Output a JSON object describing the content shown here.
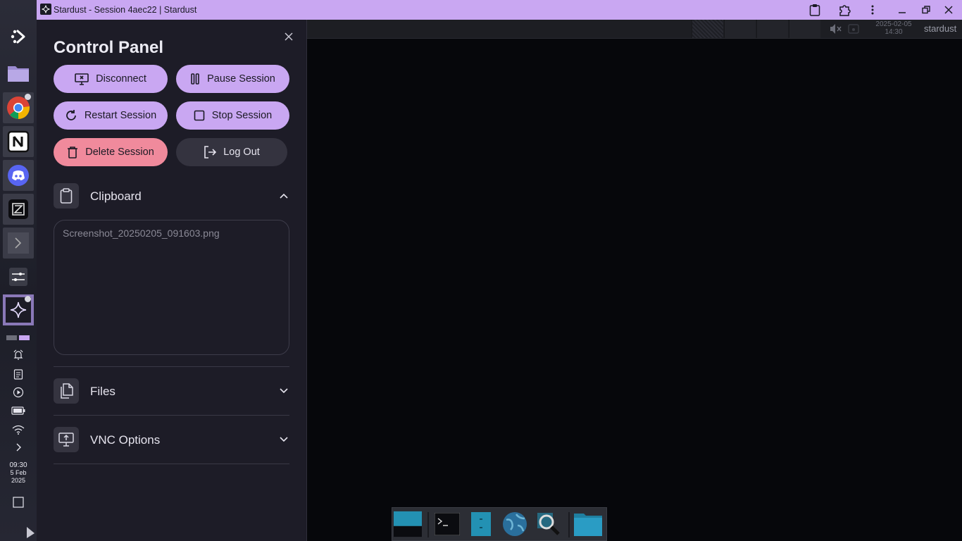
{
  "window": {
    "title": "Stardust - Session 4aec22 | Stardust"
  },
  "dock": {
    "apps": [
      {
        "name": "stardust-logo"
      },
      {
        "name": "files"
      },
      {
        "name": "chrome"
      },
      {
        "name": "notion"
      },
      {
        "name": "discord"
      },
      {
        "name": "zed"
      },
      {
        "name": "terminal"
      },
      {
        "name": "settings"
      },
      {
        "name": "stardust"
      }
    ],
    "clock": {
      "time": "09:30",
      "date": "5 Feb",
      "year": "2025"
    }
  },
  "panel": {
    "title": "Control Panel",
    "buttons": {
      "disconnect": "Disconnect",
      "pause": "Pause Session",
      "restart": "Restart Session",
      "stop": "Stop Session",
      "delete": "Delete Session",
      "logout": "Log Out"
    },
    "clipboard": {
      "label": "Clipboard",
      "value": "Screenshot_20250205_091603.png"
    },
    "files": {
      "label": "Files"
    },
    "vnc": {
      "label": "VNC Options"
    }
  },
  "remote": {
    "date": "2025-02-05",
    "time": "14:30",
    "user": "stardust"
  },
  "colors": {
    "accent": "#c9a7f2",
    "danger": "#f08a9c",
    "panel_bg": "#1d1c27"
  }
}
